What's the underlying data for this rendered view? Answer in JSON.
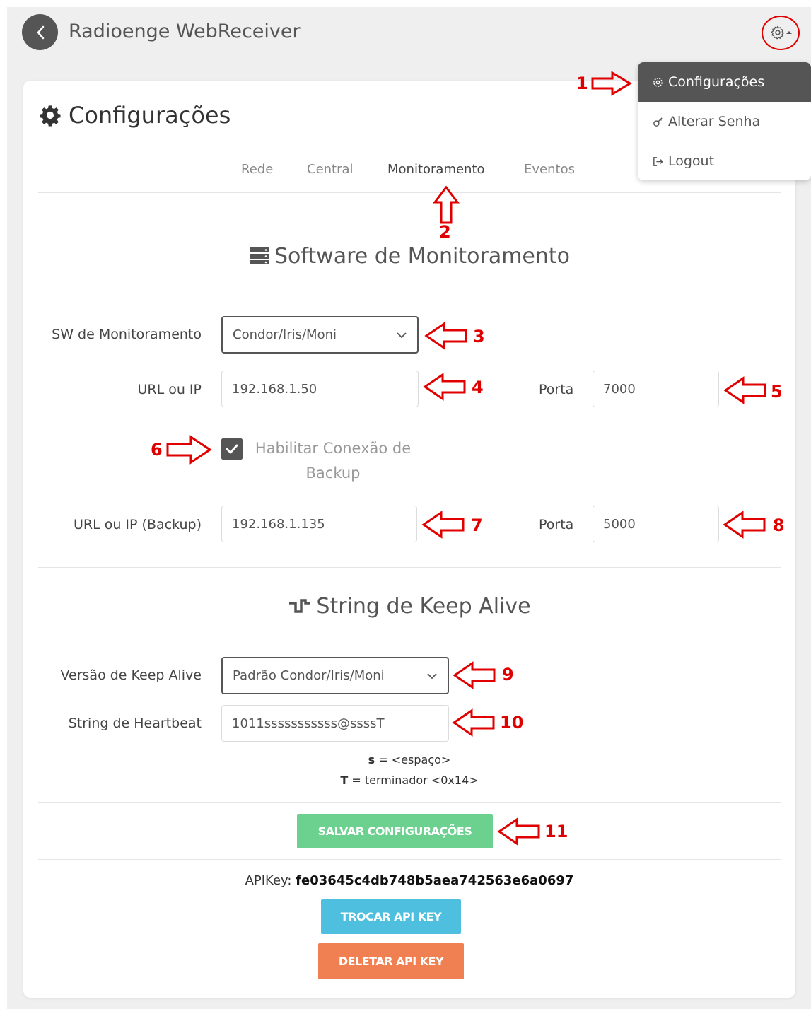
{
  "header": {
    "title": "Radioenge WebReceiver"
  },
  "dropdown": {
    "items": [
      {
        "label": "Configurações",
        "icon": "gear-icon"
      },
      {
        "label": "Alterar Senha",
        "icon": "key-icon"
      },
      {
        "label": "Logout",
        "icon": "logout-icon"
      }
    ]
  },
  "page": {
    "title": "Configurações",
    "tabs": [
      "Rede",
      "Central",
      "Monitoramento",
      "Eventos"
    ],
    "active_tab": "Monitoramento"
  },
  "monitoring": {
    "section_title": "Software de Monitoramento",
    "sw_label": "SW de Monitoramento",
    "sw_value": "Condor/Iris/Moni",
    "url_label": "URL ou IP",
    "url_value": "192.168.1.50",
    "port_label": "Porta",
    "port_value": "7000",
    "backup_checkbox_label": "Habilitar Conexão de Backup",
    "backup_checked": true,
    "backup_url_label": "URL ou IP (Backup)",
    "backup_url_value": "192.168.1.135",
    "backup_port_label": "Porta",
    "backup_port_value": "5000"
  },
  "keepalive": {
    "section_title": "String de Keep Alive",
    "version_label": "Versão de Keep Alive",
    "version_value": "Padrão Condor/Iris/Moni",
    "heartbeat_label": "String de Heartbeat",
    "heartbeat_value": "1011sssssssssss@ssssT",
    "hint_s_key": "s",
    "hint_s_text": " = <espaço>",
    "hint_t_key": "T",
    "hint_t_text": " = terminador <0x14>"
  },
  "actions": {
    "save_label": "SALVAR CONFIGURAÇÕES",
    "apikey_label": "APIKey: ",
    "apikey_value": "fe03645c4db748b5aea742563e6a0697",
    "swap_label": "TROCAR API KEY",
    "delete_label": "DELETAR API KEY"
  },
  "annotations": [
    "1",
    "2",
    "3",
    "4",
    "5",
    "6",
    "7",
    "8",
    "9",
    "10",
    "11"
  ],
  "colors": {
    "save": "#6cd08e",
    "swap": "#4fbfdf",
    "delete": "#f08052",
    "annotation": "#e00000",
    "dark": "#555555"
  }
}
